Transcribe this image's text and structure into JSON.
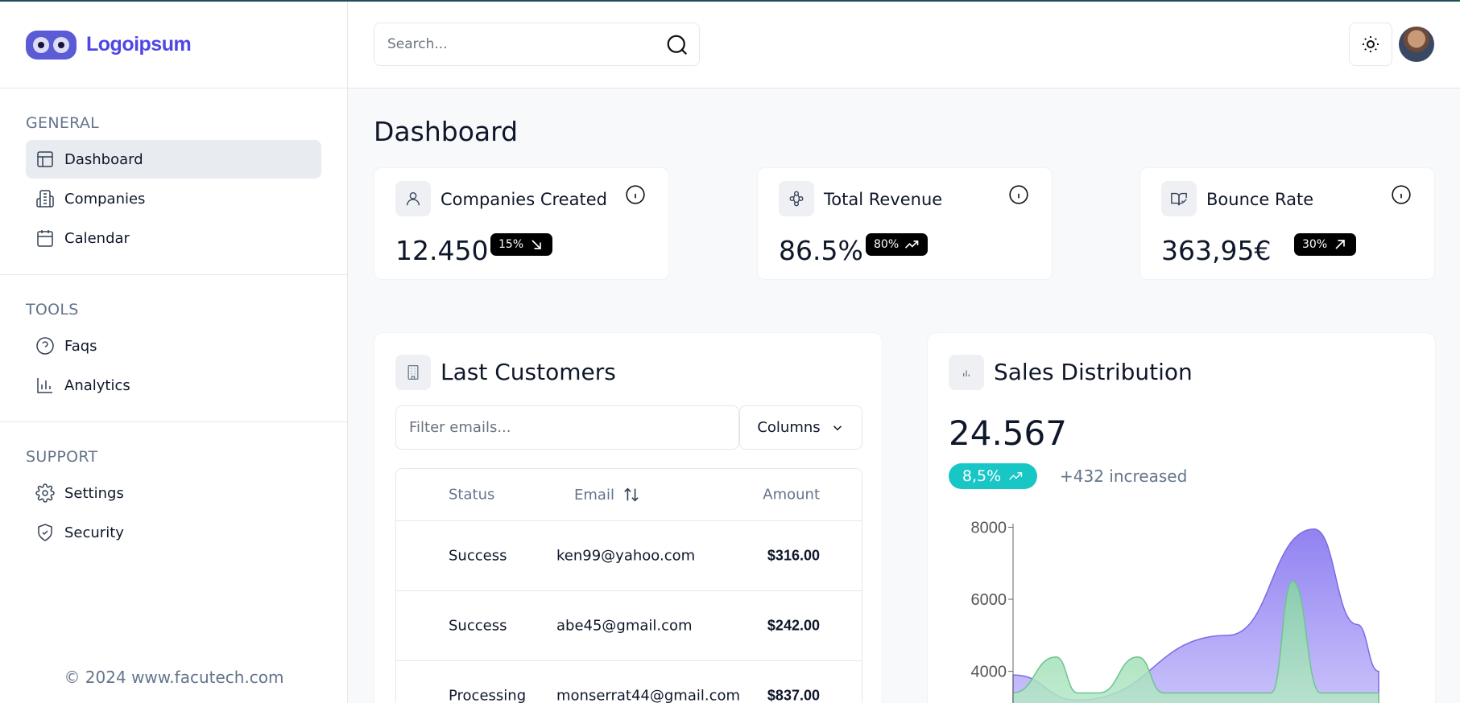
{
  "brand": {
    "name": "Logoipsum"
  },
  "search": {
    "placeholder": "Search..."
  },
  "sidebar": {
    "sections": [
      {
        "heading": "GENERAL",
        "items": [
          {
            "label": "Dashboard",
            "icon": "layout-icon",
            "active": true
          },
          {
            "label": "Companies",
            "icon": "building-icon"
          },
          {
            "label": "Calendar",
            "icon": "calendar-icon"
          }
        ]
      },
      {
        "heading": "TOOLS",
        "items": [
          {
            "label": "Faqs",
            "icon": "help-circle-icon"
          },
          {
            "label": "Analytics",
            "icon": "bar-chart-icon"
          }
        ]
      },
      {
        "heading": "SUPPORT",
        "items": [
          {
            "label": "Settings",
            "icon": "gear-icon"
          },
          {
            "label": "Security",
            "icon": "shield-icon"
          }
        ]
      }
    ],
    "footer": "© 2024 www.facutech.com"
  },
  "page": {
    "title": "Dashboard"
  },
  "stats": [
    {
      "title": "Companies Created",
      "value": "12.450",
      "badge": "15%",
      "trend": "down"
    },
    {
      "title": "Total Revenue",
      "value": "86.5%",
      "badge": "80%",
      "trend": "up"
    },
    {
      "title": "Bounce Rate",
      "value": "363,95€",
      "badge": "30%",
      "trend": "up-right"
    }
  ],
  "customers": {
    "title": "Last Customers",
    "filter_placeholder": "Filter emails...",
    "columns_label": "Columns",
    "headers": {
      "status": "Status",
      "email": "Email",
      "amount": "Amount"
    },
    "rows": [
      {
        "status": "Success",
        "email": "ken99@yahoo.com",
        "amount": "$316.00"
      },
      {
        "status": "Success",
        "email": "abe45@gmail.com",
        "amount": "$242.00"
      },
      {
        "status": "Processing",
        "email": "monserrat44@gmail.com",
        "amount": "$837.00"
      }
    ]
  },
  "sales": {
    "title": "Sales Distribution",
    "value": "24.567",
    "growth_badge": "8,5%",
    "growth_note": "+432 increased"
  },
  "chart_data": {
    "type": "area",
    "y_ticks": [
      8000,
      6000,
      4000
    ],
    "ylim": [
      3500,
      8100
    ],
    "series": [
      {
        "x": [
          0,
          3,
          10,
          14,
          16,
          17
        ],
        "values": [
          3900,
          3200,
          5000,
          7950,
          5300,
          4000
        ],
        "color": "#8b7cf0"
      },
      {
        "x": [
          0,
          2,
          3,
          4,
          5.8,
          7,
          8,
          12,
          13,
          14.3,
          15.5,
          17
        ],
        "values": [
          3400,
          4400,
          3400,
          3400,
          4400,
          3400,
          3400,
          3400,
          6500,
          3400,
          3400,
          3400
        ],
        "color": "#86d6a4"
      }
    ],
    "grid": false
  },
  "colors": {
    "accent": "#4f46e5",
    "teal": "#19c6c6",
    "purple": "#8b7cf0",
    "green": "#86d6a4"
  }
}
